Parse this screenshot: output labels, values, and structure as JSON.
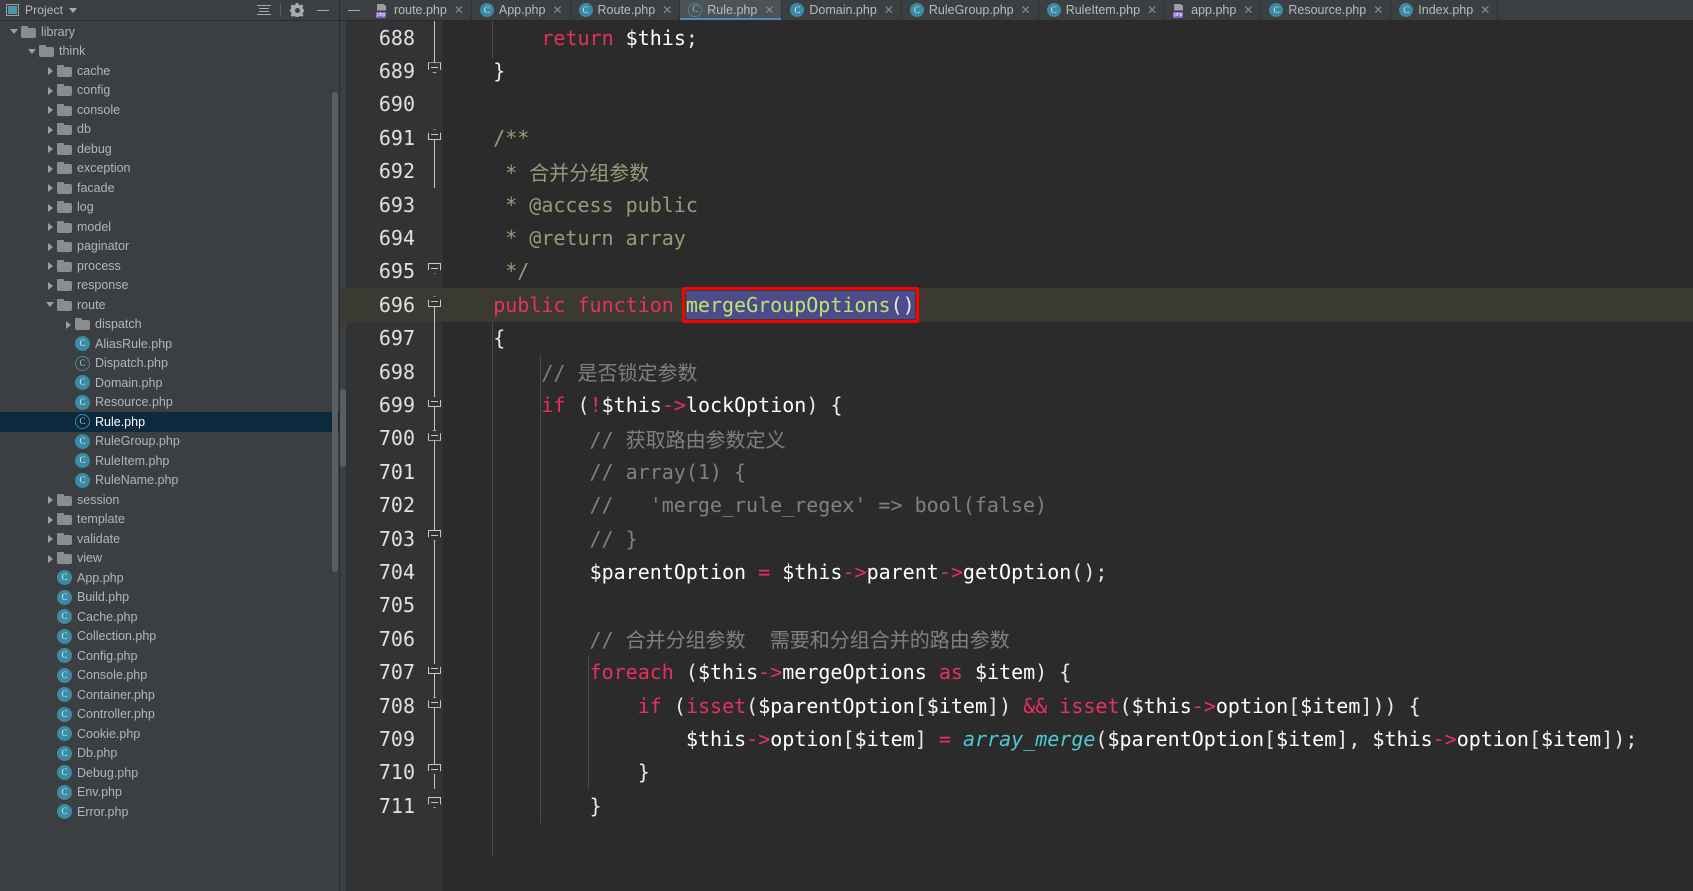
{
  "project_panel": {
    "title": "Project",
    "icons": {
      "window": "project-window-icon",
      "dropdown": "chevron-down-icon",
      "collapse_all": "collapse-all-icon",
      "settings": "gear-icon",
      "hide": "minimize-icon"
    },
    "tree": [
      {
        "label": "library",
        "depth": 1,
        "type": "folder",
        "state": "open"
      },
      {
        "label": "think",
        "depth": 2,
        "type": "folder",
        "state": "open"
      },
      {
        "label": "cache",
        "depth": 3,
        "type": "folder",
        "state": "closed"
      },
      {
        "label": "config",
        "depth": 3,
        "type": "folder",
        "state": "closed"
      },
      {
        "label": "console",
        "depth": 3,
        "type": "folder",
        "state": "closed"
      },
      {
        "label": "db",
        "depth": 3,
        "type": "folder",
        "state": "closed"
      },
      {
        "label": "debug",
        "depth": 3,
        "type": "folder",
        "state": "closed"
      },
      {
        "label": "exception",
        "depth": 3,
        "type": "folder",
        "state": "closed"
      },
      {
        "label": "facade",
        "depth": 3,
        "type": "folder",
        "state": "closed"
      },
      {
        "label": "log",
        "depth": 3,
        "type": "folder",
        "state": "closed"
      },
      {
        "label": "model",
        "depth": 3,
        "type": "folder",
        "state": "closed"
      },
      {
        "label": "paginator",
        "depth": 3,
        "type": "folder",
        "state": "closed"
      },
      {
        "label": "process",
        "depth": 3,
        "type": "folder",
        "state": "closed"
      },
      {
        "label": "response",
        "depth": 3,
        "type": "folder",
        "state": "closed"
      },
      {
        "label": "route",
        "depth": 3,
        "type": "folder",
        "state": "open"
      },
      {
        "label": "dispatch",
        "depth": 4,
        "type": "folder",
        "state": "closed"
      },
      {
        "label": "AliasRule.php",
        "depth": 4,
        "type": "class"
      },
      {
        "label": "Dispatch.php",
        "depth": 4,
        "type": "abstract-class"
      },
      {
        "label": "Domain.php",
        "depth": 4,
        "type": "class"
      },
      {
        "label": "Resource.php",
        "depth": 4,
        "type": "class"
      },
      {
        "label": "Rule.php",
        "depth": 4,
        "type": "abstract-class",
        "selected": true
      },
      {
        "label": "RuleGroup.php",
        "depth": 4,
        "type": "class"
      },
      {
        "label": "RuleItem.php",
        "depth": 4,
        "type": "class"
      },
      {
        "label": "RuleName.php",
        "depth": 4,
        "type": "class"
      },
      {
        "label": "session",
        "depth": 3,
        "type": "folder",
        "state": "closed"
      },
      {
        "label": "template",
        "depth": 3,
        "type": "folder",
        "state": "closed"
      },
      {
        "label": "validate",
        "depth": 3,
        "type": "folder",
        "state": "closed"
      },
      {
        "label": "view",
        "depth": 3,
        "type": "folder",
        "state": "closed"
      },
      {
        "label": "App.php",
        "depth": 3,
        "type": "class"
      },
      {
        "label": "Build.php",
        "depth": 3,
        "type": "class"
      },
      {
        "label": "Cache.php",
        "depth": 3,
        "type": "class"
      },
      {
        "label": "Collection.php",
        "depth": 3,
        "type": "class"
      },
      {
        "label": "Config.php",
        "depth": 3,
        "type": "class"
      },
      {
        "label": "Console.php",
        "depth": 3,
        "type": "class"
      },
      {
        "label": "Container.php",
        "depth": 3,
        "type": "class"
      },
      {
        "label": "Controller.php",
        "depth": 3,
        "type": "class"
      },
      {
        "label": "Cookie.php",
        "depth": 3,
        "type": "class"
      },
      {
        "label": "Db.php",
        "depth": 3,
        "type": "class"
      },
      {
        "label": "Debug.php",
        "depth": 3,
        "type": "class"
      },
      {
        "label": "Env.php",
        "depth": 3,
        "type": "class"
      },
      {
        "label": "Error.php",
        "depth": 3,
        "type": "class"
      }
    ]
  },
  "tabs": {
    "hide_label": "—",
    "items": [
      {
        "label": "route.php",
        "icon": "php-file-icon",
        "active": false
      },
      {
        "label": "App.php",
        "icon": "php-class-icon",
        "active": false
      },
      {
        "label": "Route.php",
        "icon": "php-class-icon",
        "active": false
      },
      {
        "label": "Rule.php",
        "icon": "php-abstract-icon",
        "active": true
      },
      {
        "label": "Domain.php",
        "icon": "php-class-icon",
        "active": false
      },
      {
        "label": "RuleGroup.php",
        "icon": "php-class-icon",
        "active": false
      },
      {
        "label": "RuleItem.php",
        "icon": "php-class-icon",
        "active": false
      },
      {
        "label": "app.php",
        "icon": "php-file-icon",
        "active": false
      },
      {
        "label": "Resource.php",
        "icon": "php-class-icon",
        "active": false
      },
      {
        "label": "Index.php",
        "icon": "php-class-icon",
        "active": false
      }
    ],
    "close_glyph": "✕"
  },
  "editor": {
    "caret_line": 696,
    "highlight": {
      "color": "#ff0000",
      "target_text": "mergeGroupOptions()"
    },
    "lines": [
      {
        "n": 688,
        "text": "        return $this;"
      },
      {
        "n": 689,
        "text": "    }"
      },
      {
        "n": 690,
        "text": ""
      },
      {
        "n": 691,
        "text": "    /**"
      },
      {
        "n": 692,
        "text": "     * 合并分组参数"
      },
      {
        "n": 693,
        "text": "     * @access public"
      },
      {
        "n": 694,
        "text": "     * @return array"
      },
      {
        "n": 695,
        "text": "     */"
      },
      {
        "n": 696,
        "text": "    public function mergeGroupOptions()"
      },
      {
        "n": 697,
        "text": "    {"
      },
      {
        "n": 698,
        "text": "        // 是否锁定参数"
      },
      {
        "n": 699,
        "text": "        if (!$this->lockOption) {"
      },
      {
        "n": 700,
        "text": "            // 获取路由参数定义"
      },
      {
        "n": 701,
        "text": "            // array(1) {"
      },
      {
        "n": 702,
        "text": "            //   'merge_rule_regex' => bool(false)"
      },
      {
        "n": 703,
        "text": "            // }"
      },
      {
        "n": 704,
        "text": "            $parentOption = $this->parent->getOption();"
      },
      {
        "n": 705,
        "text": ""
      },
      {
        "n": 706,
        "text": "            // 合并分组参数  需要和分组合并的路由参数"
      },
      {
        "n": 707,
        "text": "            foreach ($this->mergeOptions as $item) {"
      },
      {
        "n": 708,
        "text": "                if (isset($parentOption[$item]) && isset($this->option[$item])) {"
      },
      {
        "n": 709,
        "text": "                    $this->option[$item] = array_merge($parentOption[$item], $this->option[$item]);"
      },
      {
        "n": 710,
        "text": "                }"
      },
      {
        "n": 711,
        "text": "            }"
      }
    ],
    "colors": {
      "background": "#2b2b2b",
      "gutter": "#313335",
      "line_number": "#e0e0e0",
      "comment": "#808080",
      "keyword": "#e8305f",
      "function_name": "#b9e76b",
      "builtin_function": "#4ec9d6",
      "caret_line_bg": "#3a3a32",
      "selection_bg": "#4e4b8c"
    }
  }
}
